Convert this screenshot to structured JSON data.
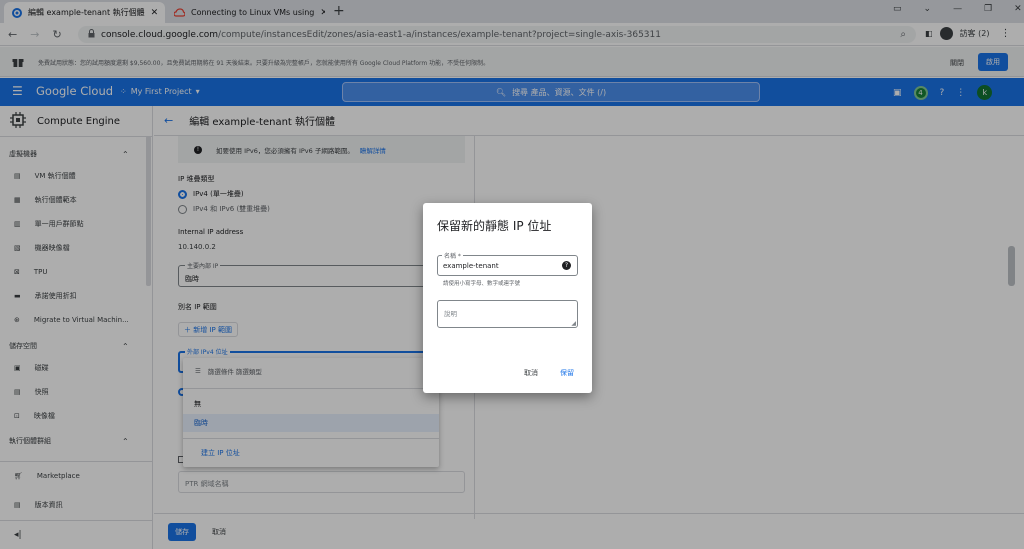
{
  "browser": {
    "tabs": [
      {
        "title": "編輯 example-tenant 執行個體"
      },
      {
        "title": "Connecting to Linux VMs using"
      }
    ],
    "url_prefix": "console.cloud.google.com",
    "url_rest": "/compute/instancesEdit/zones/asia-east1-a/instances/example-tenant?project=single-axis-365311",
    "profile": "訪客 (2)"
  },
  "banner": {
    "text": "免費試用狀態：您的試用額度還剩 $9,560.00，且免費試用期將在 91 天後結束。只要升級為完整帳戶，您就能使用所有 Google Cloud Platform 功能，不受任何限制。",
    "close": "關閉",
    "activate": "啟用"
  },
  "header": {
    "logo": "Google Cloud",
    "project": "My First Project",
    "search_placeholder": "搜尋 產品、資源、文件 (/)",
    "notif_count": "4",
    "avatar": "k"
  },
  "sidebar": {
    "product": "Compute Engine",
    "sections": [
      {
        "title": "虛擬機器"
      },
      {
        "title": "儲存空間"
      },
      {
        "title": "執行個體群組"
      }
    ],
    "vm_items": [
      "VM 執行個體",
      "執行個體範本",
      "單一用戶群節點",
      "機器映像檔",
      "TPU",
      "承諾使用折扣",
      "Migrate to Virtual Machin..."
    ],
    "storage_items": [
      "磁碟",
      "快照",
      "映像檔"
    ],
    "marketplace": "Marketplace",
    "release_notes": "版本資訊"
  },
  "page": {
    "title": "編輯 example-tenant 執行個體",
    "ipv6_info": "如要使用 IPv6，您必須擁有 IPv6 子網路範圍。",
    "ipv6_link": "瞭解詳情",
    "ip_stack_label": "IP 堆疊類型",
    "ipv4_option": "IPv4 (單一堆疊)",
    "dual_option": "IPv4 和 IPv6 (雙重堆疊)",
    "internal_ip_label": "Internal IP address",
    "internal_ip_value": "10.140.0.2",
    "primary_ip_label": "主要內部 IP",
    "primary_ip_value": "臨時",
    "alias_label": "別名 IP 範圍",
    "add_alias": "＋ 新增 IP 範圍",
    "ext_ip_label": "外部 IPv4 位址",
    "ptr_placeholder": "PTR 網域名稱",
    "save": "儲存",
    "cancel": "取消"
  },
  "dropdown": {
    "filter": "篩選條件 篩選類型",
    "options": [
      "無",
      "臨時"
    ],
    "create": "建立 IP 位址"
  },
  "dialog": {
    "title": "保留新的靜態 IP 位址",
    "name_label": "名稱 *",
    "name_value": "example-tenant",
    "name_hint": "請使用小寫字母、數字或連字號",
    "desc_placeholder": "說明",
    "cancel": "取消",
    "save": "保留"
  }
}
